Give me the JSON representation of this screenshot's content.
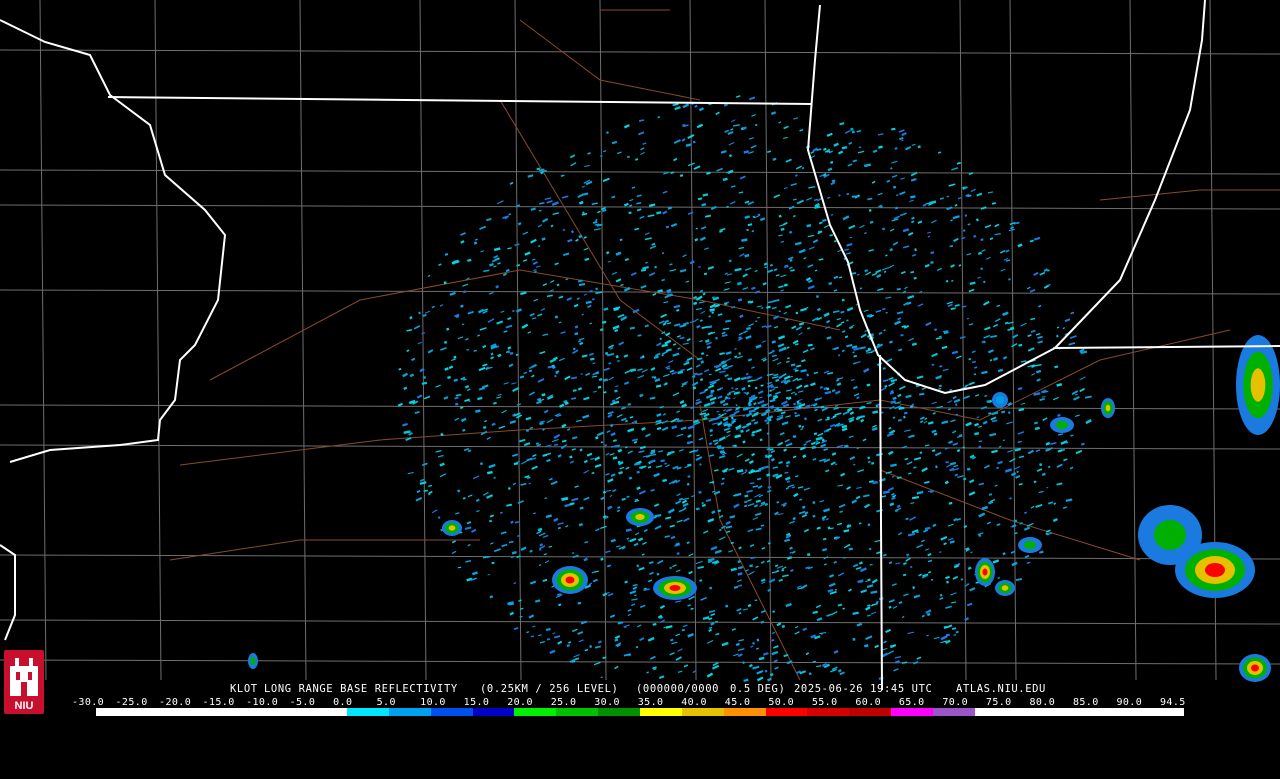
{
  "product": {
    "station": "KLOT",
    "title": "LONG RANGE BASE REFLECTIVITY",
    "resolution": "(0.25KM / 256 LEVEL)",
    "volume": "(000000/0000",
    "elevation": "0.5 DEG)",
    "datetime": "2025-06-26 19:45 UTC",
    "source": "ATLAS.NIU.EDU"
  },
  "logo": {
    "text": "NIU",
    "color": "#c8102e"
  },
  "legend": {
    "ticks": [
      "-30.0",
      "-25.0",
      "-20.0",
      "-15.0",
      "-10.0",
      "-5.0",
      "0.0",
      "5.0",
      "10.0",
      "15.0",
      "20.0",
      "25.0",
      "30.0",
      "35.0",
      "40.0",
      "45.0",
      "50.0",
      "55.0",
      "60.0",
      "65.0",
      "70.0",
      "75.0",
      "80.0",
      "85.0",
      "90.0",
      "94.5"
    ],
    "colors": [
      "#ffffff",
      "#ffffff",
      "#ffffff",
      "#ffffff",
      "#ffffff",
      "#ffffff",
      "#00e6ff",
      "#00a0f0",
      "#0050f0",
      "#0000c8",
      "#00f000",
      "#00c000",
      "#009000",
      "#ffff00",
      "#e7c000",
      "#ff9000",
      "#ff0000",
      "#d60000",
      "#c00000",
      "#ff00ff",
      "#9955c9",
      "#ffffff",
      "#ffffff",
      "#ffffff",
      "#ffffff",
      "#ffffff"
    ]
  },
  "map_colors": {
    "background": "#000000",
    "state_borders": "#ffffff",
    "county_lines": "#6e6e6e",
    "highways": "#8a4a2a"
  }
}
